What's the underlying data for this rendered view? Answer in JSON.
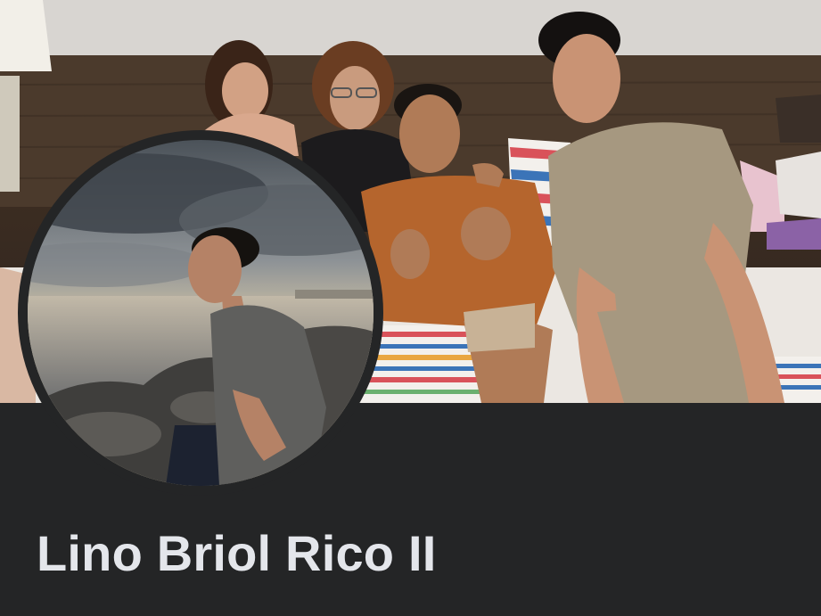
{
  "profile": {
    "name": "Lino Briol Rico II"
  },
  "theme": {
    "background": "#242526",
    "name_color": "#e4e6eb"
  },
  "cover_photo": {
    "icon": "cover-photo"
  },
  "profile_picture": {
    "icon": "profile-photo"
  }
}
